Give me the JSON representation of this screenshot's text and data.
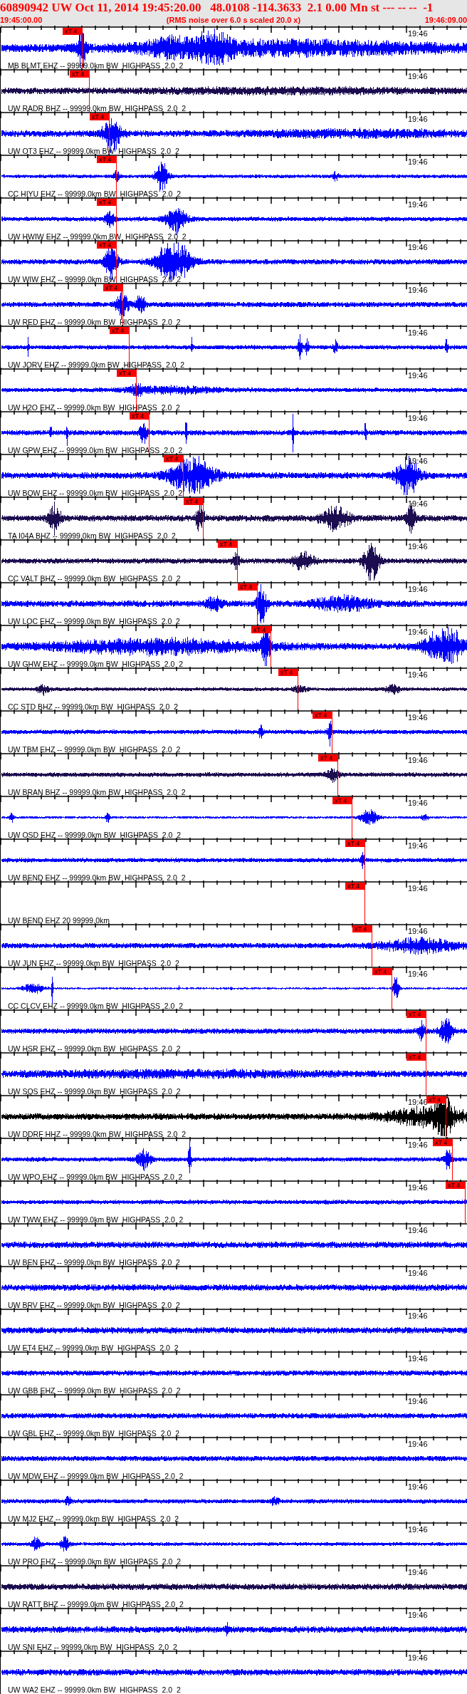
{
  "header": {
    "title": "60890942 UW Oct 11, 2014 19:45:20.00   48.0108 -114.3633  2.1 0.00 Mn st --- -- --  -1",
    "start_time": "19:45:00.00",
    "note": "(RMS noise over 6.0 s scaled 20.0 x)",
    "end_time": "19:46:09.00"
  },
  "traces": [
    {
      "label": "MB BLMT EHZ -- 99999.0km BW  HIGHPASS  2.0  2",
      "time_label": "19:46",
      "pick": "xT 4",
      "color": "#0000ff"
    },
    {
      "label": "UW RADR BHZ -- 99999.0km BW  HIGHPASS  2.0  2",
      "time_label": "19:46",
      "pick": "xT 4",
      "color": "#1c0c50"
    },
    {
      "label": "UW OT3 EHZ -- 99999.0km BW  HIGHPASS  2.0  2",
      "time_label": "19:46",
      "pick": "xT 4",
      "color": "#0000ff"
    },
    {
      "label": "CC HIYU EHZ -- 99999.0km BW  HIGHPASS  2.0  2",
      "time_label": "19:46",
      "pick": "xT 4",
      "color": "#0000ff"
    },
    {
      "label": "UW HWIW EHZ -- 99999.0km BW  HIGHPASS  2.0  2",
      "time_label": "19:46",
      "pick": "xT 4",
      "color": "#0000ff"
    },
    {
      "label": "UW WIW EHZ -- 99999.0km BW  HIGHPASS  2.0  2",
      "time_label": "19:46",
      "pick": "xT 4",
      "color": "#0000ff"
    },
    {
      "label": "UW RED EHZ -- 99999.0km BW  HIGHPASS  2.0  2",
      "time_label": "19:46",
      "pick": "xT 4",
      "color": "#0000ff"
    },
    {
      "label": "UW JORV EHZ -- 99999.0km BW  HIGHPASS  2.0  2",
      "time_label": "19:46",
      "pick": "xT 4",
      "color": "#0000ff"
    },
    {
      "label": "UW H2O EHZ -- 99999.0km BW  HIGHPASS  2.0  2",
      "time_label": "19:46",
      "pick": "xT 4",
      "color": "#0000ff"
    },
    {
      "label": "UW GPW EHZ -- 99999.0km BW  HIGHPASS  2.0  2",
      "time_label": "19:46",
      "pick": "xT 4",
      "color": "#0000ff"
    },
    {
      "label": "UW BQW EHZ -- 99999.0km BW  HIGHPASS  2.0  2",
      "time_label": "19:46",
      "pick": "xT 4",
      "color": "#0000ff"
    },
    {
      "label": "TA I04A BHZ -- 99999.0km BW  HIGHPASS  2.0  2",
      "time_label": "19:46",
      "pick": "xT 4",
      "color": "#1c0c50"
    },
    {
      "label": "CC VALT BHZ -- 99999.0km BW  HIGHPASS  2.0  2",
      "time_label": "19:46",
      "pick": "xT 4",
      "color": "#1c0c50"
    },
    {
      "label": "UW LOC EHZ -- 99999.0km BW  HIGHPASS  2.0  2",
      "time_label": "19:46",
      "pick": "xT 4",
      "color": "#0000ff"
    },
    {
      "label": "UW GHW EHZ -- 99999.0km BW  HIGHPASS  2.0  2",
      "time_label": "19:46",
      "pick": "xT 4",
      "color": "#0000ff"
    },
    {
      "label": "CC STD BHZ -- 99999.0km BW  HIGHPASS  2.0  2",
      "time_label": "19:46",
      "pick": "xT 4",
      "color": "#1c0c50"
    },
    {
      "label": "UW TBM EHZ -- 99999.0km BW  HIGHPASS  2.0  2",
      "time_label": "19:46",
      "pick": "xT 4",
      "color": "#0000ff"
    },
    {
      "label": "UW BRAN BHZ -- 99999.0km BW  HIGHPASS  2.0  2",
      "time_label": "19:46",
      "pick": "xT 4",
      "color": "#1c0c50"
    },
    {
      "label": "UW OSD EHZ -- 99999.0km BW  HIGHPASS  2.0  2",
      "time_label": "19:46",
      "pick": "xT 4",
      "color": "#0000ff"
    },
    {
      "label": "UW BEND EHZ -- 99999.0km BW  HIGHPASS  2.0  2",
      "time_label": "19:46",
      "pick": "xT 4",
      "color": "#0000ff"
    },
    {
      "label": "UW BEND EHZ 20 99999.0km",
      "time_label": "19:46",
      "pick": "xT 4"
    },
    {
      "label": "UW JUN EHZ -- 99999.0km BW  HIGHPASS  2.0  2",
      "time_label": "19:46",
      "pick": "xT 4",
      "color": "#0000ff"
    },
    {
      "label": "CC CLCV EHZ -- 99999.0km BW  HIGHPASS  2.0  2",
      "time_label": "19:46",
      "pick": "xT 4",
      "color": "#0000ff"
    },
    {
      "label": "UW HSR EHZ -- 99999.0km BW  HIGHPASS  2.0  2",
      "pick": "xT 4",
      "color": "#0000ff"
    },
    {
      "label": "UW SQS EHZ -- 99999.0km BW  HIGHPASS  2.0  2",
      "pick": "xT 4",
      "color": "#0000ff"
    },
    {
      "label": "UW DDRF HHZ -- 99999.0km BW  HIGHPASS  2.0  2",
      "time_label": "19:46",
      "pick": "xT 4",
      "color": "#000000"
    },
    {
      "label": "UW WPO EHZ -- 99999.0km BW  HIGHPASS  2.0  2",
      "time_label": "19:46",
      "pick": "xT 4",
      "color": "#0000ff"
    },
    {
      "label": "UW TWW EHZ -- 99999.0km BW  HIGHPASS  2.0  2",
      "time_label": "19:46",
      "pick": "xT 4",
      "color": "#0000ff"
    },
    {
      "label": "UW BEN EHZ -- 99999.0km BW  HIGHPASS  2.0  2",
      "time_label": "19:46",
      "color": "#0000ff"
    },
    {
      "label": "UW BRV EHZ -- 99999.0km BW  HIGHPASS  2.0  2",
      "time_label": "19:46",
      "color": "#0000ff"
    },
    {
      "label": "UW ET4 EHZ -- 99999.0km BW  HIGHPASS  2.0  2",
      "time_label": "19:46",
      "color": "#0000ff"
    },
    {
      "label": "UW GBB EHZ -- 99999.0km BW  HIGHPASS  2.0  2",
      "time_label": "19:46",
      "color": "#0000ff"
    },
    {
      "label": "UW GBL EHZ -- 99999.0km BW  HIGHPASS  2.0  2",
      "time_label": "19:46",
      "color": "#0000ff"
    },
    {
      "label": "UW MDW EHZ -- 99999.0km BW  HIGHPASS  2.0  2",
      "time_label": "19:46",
      "color": "#0000ff"
    },
    {
      "label": "UW MJ2 EHZ -- 99999.0km BW  HIGHPASS  2.0  2",
      "time_label": "19:46",
      "color": "#0000ff"
    },
    {
      "label": "UW PRO EHZ -- 99999.0km BW  HIGHPASS  2.0  2",
      "time_label": "19:46",
      "color": "#0000ff"
    },
    {
      "label": "UW RATT BHZ -- 99999.0km BW  HIGHPASS  2.0  2",
      "time_label": "19:46",
      "color": "#1c0c50"
    },
    {
      "label": "UW SNI EHZ -- 99999.0km BW  HIGHPASS  2.0  2",
      "time_label": "19:46",
      "color": "#0000ff"
    },
    {
      "label": "UW WA2 EHZ -- 99999.0km BW  HIGHPASS  2.0  2",
      "time_label": "19:46",
      "color": "#0000ff"
    }
  ]
}
